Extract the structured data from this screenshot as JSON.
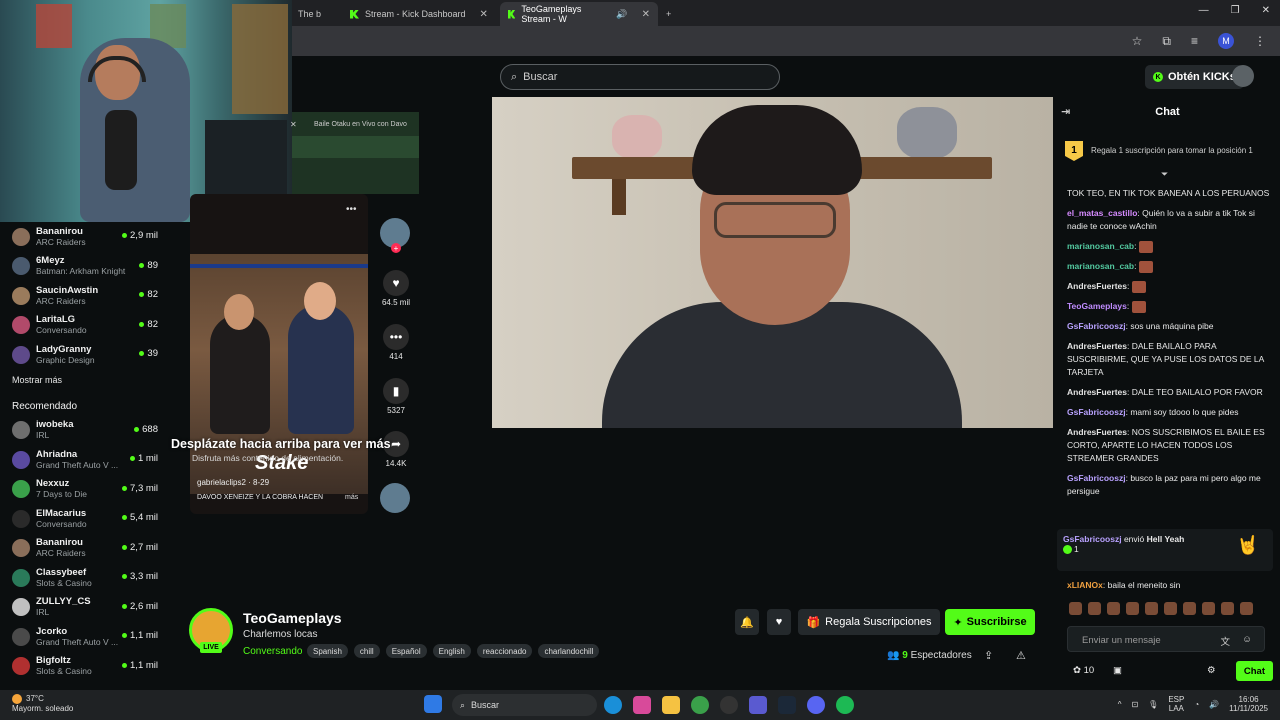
{
  "browser": {
    "tabs": [
      {
        "label": "The b"
      },
      {
        "label": "Stream - Kick Dashboard"
      },
      {
        "label": "TeoGameplays Stream - W"
      }
    ],
    "profile_initial": "M"
  },
  "header": {
    "search_placeholder": "Buscar",
    "kicks_button": "Obtén KICKs"
  },
  "sidebar": {
    "following": [
      {
        "name": "Bananirou",
        "game": "ARC Raiders",
        "viewers": "2,9 mil",
        "color": "#8a6e5a"
      },
      {
        "name": "6Meyz",
        "game": "Batman: Arkham Knight",
        "viewers": "89",
        "color": "#4a5a6e"
      },
      {
        "name": "SaucinAwstin",
        "game": "ARC Raiders",
        "viewers": "82",
        "color": "#9a7b5c"
      },
      {
        "name": "LaritaLG",
        "game": "Conversando",
        "viewers": "82",
        "color": "#b14a6a"
      },
      {
        "name": "LadyGranny",
        "game": "Graphic Design",
        "viewers": "39",
        "color": "#5e4a8a"
      }
    ],
    "show_more": "Mostrar más",
    "recommended_title": "Recomendado",
    "recommended": [
      {
        "name": "iwobeka",
        "game": "IRL",
        "viewers": "688",
        "color": "#6e6e6e"
      },
      {
        "name": "Ahriadna",
        "game": "Grand Theft Auto V ...",
        "viewers": "1 mil",
        "color": "#5a4aa0"
      },
      {
        "name": "Nexxuz",
        "game": "7 Days to Die",
        "viewers": "7,3 mil",
        "color": "#3aa04a"
      },
      {
        "name": "ElMacarius",
        "game": "Conversando",
        "viewers": "5,4 mil",
        "color": "#2a2a2a"
      },
      {
        "name": "Bananirou",
        "game": "ARC Raiders",
        "viewers": "2,7 mil",
        "color": "#8a6e5a"
      },
      {
        "name": "Classybeef",
        "game": "Slots & Casino",
        "viewers": "3,3 mil",
        "color": "#2a7a5a"
      },
      {
        "name": "ZULLYY_CS",
        "game": "IRL",
        "viewers": "2,6 mil",
        "color": "#c0c0c0"
      },
      {
        "name": "Jcorko",
        "game": "Grand Theft Auto V ...",
        "viewers": "1,1 mil",
        "color": "#4a4a4a"
      },
      {
        "name": "Bigfoltz",
        "game": "Slots & Casino",
        "viewers": "1,1 mil",
        "color": "#b03030"
      }
    ]
  },
  "tiktok": {
    "bar_title": "Baile Otaku en Vivo con Davo",
    "likes": "64.5 mil",
    "comments": "414",
    "saves": "5327",
    "shares": "14.4K",
    "user": "gabrielaclips2 · 8-29",
    "caption": "DAVOO XENEIZE Y LA COBRA HACEN",
    "more": "más",
    "overlay_stake": "Stake",
    "scroll_hint": "Desplázate hacia arriba para ver más",
    "scroll_sub": "Disfruta más contenido de alimentación."
  },
  "stream": {
    "name": "TeoGameplays",
    "title": "Charlemos locas",
    "category": "Conversando",
    "live_badge": "LIVE",
    "tags": [
      "Spanish",
      "chill",
      "Español",
      "English",
      "reaccionado",
      "charlandochill"
    ],
    "gift_button": "Regala Suscripciones",
    "subscribe_button": "Suscribirse",
    "viewers_count": "9",
    "viewers_label": "Espectadores"
  },
  "chat": {
    "title": "Chat",
    "gift_prompt": "Regala 1 suscripción para tomar la posición 1",
    "gift_rank": "1",
    "messages": [
      {
        "user": "",
        "text": "TOK TEO, EN TIK TOK BANEAN A LOS PERUANOS",
        "color": "#e8e8e8"
      },
      {
        "user": "el_matas_castillo",
        "text": "Quién lo va a subir a tik Tok si nadie te conoce wAchin",
        "color": "#d68bff"
      },
      {
        "user": "marianosan_cab",
        "text": "",
        "color": "#53c9a0"
      },
      {
        "user": "marianosan_cab",
        "text": "",
        "color": "#53c9a0"
      },
      {
        "user": "AndresFuertes",
        "text": "",
        "color": "#e4e4e4"
      },
      {
        "user": "TeoGameplays",
        "text": "",
        "color": "#c08cff"
      },
      {
        "user": "GsFabricooszj",
        "text": "sos una máquina pibe",
        "color": "#b9a2ff"
      },
      {
        "user": "AndresFuertes",
        "text": "DALE BAILALO PARA SUSCRIBIRME, QUE YA PUSE LOS DATOS DE LA TARJETA",
        "color": "#e4e4e4"
      },
      {
        "user": "AndresFuertes",
        "text": "DALE TEO BAILALO POR FAVOR",
        "color": "#e4e4e4"
      },
      {
        "user": "GsFabricooszj",
        "text": "mami soy tdooo lo que pides",
        "color": "#b9a2ff"
      },
      {
        "user": "AndresFuertes",
        "text": "NOS SUSCRIBIMOS EL BAILE ES CORTO, APARTE LO HACEN TODOS LOS STREAMER GRANDES",
        "color": "#e4e4e4"
      },
      {
        "user": "GsFabricooszj",
        "text": "busco la paz para mi pero algo me persigue",
        "color": "#b9a2ff"
      }
    ],
    "hell": {
      "user": "GsFabricooszj",
      "action": "envió",
      "item": "Hell Yeah",
      "count": "1"
    },
    "last_msg": {
      "user": "xLIANOx",
      "text": "baila el meneito sin",
      "color": "#f0a040"
    },
    "input_placeholder": "Enviar un mensaje",
    "points": "10",
    "chat_button": "Chat"
  },
  "taskbar": {
    "temp": "37°C",
    "weather": "Mayorm. soleado",
    "search": "Buscar",
    "lang": "ESP",
    "lang2": "LAA",
    "time": "16:06",
    "date": "11/11/2025"
  }
}
